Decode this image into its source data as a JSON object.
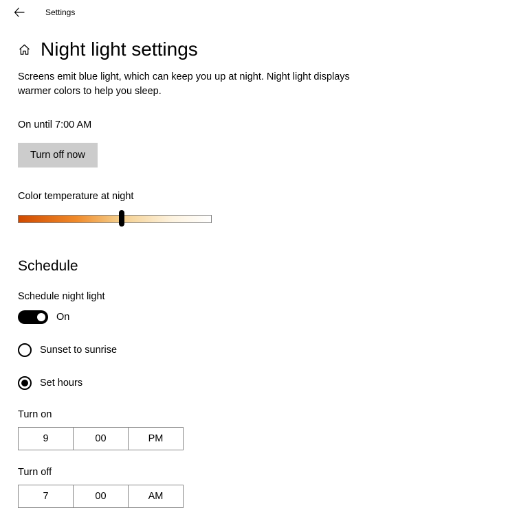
{
  "app_title": "Settings",
  "page_title": "Night light settings",
  "description": "Screens emit blue light, which can keep you up at night. Night light displays warmer colors to help you sleep.",
  "status": "On until 7:00 AM",
  "turn_off_button": "Turn off now",
  "color_temp": {
    "label": "Color temperature at night",
    "value_percent": 52
  },
  "schedule": {
    "heading": "Schedule",
    "toggle_label": "Schedule night light",
    "toggle_state_text": "On",
    "toggle_on": true,
    "options": {
      "sunset": "Sunset to sunrise",
      "set_hours": "Set hours",
      "selected": "set_hours"
    },
    "turn_on": {
      "label": "Turn on",
      "hour": "9",
      "minute": "00",
      "ampm": "PM"
    },
    "turn_off": {
      "label": "Turn off",
      "hour": "7",
      "minute": "00",
      "ampm": "AM"
    }
  }
}
